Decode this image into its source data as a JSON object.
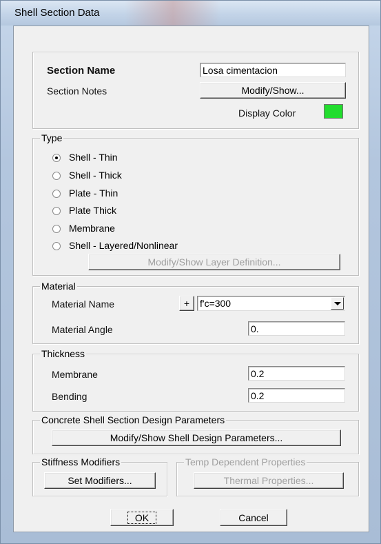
{
  "window": {
    "title": "Shell Section Data"
  },
  "colors": {
    "display_color": "#22dd2e"
  },
  "section": {
    "name_label": "Section Name",
    "name_value": "Losa cimentacion",
    "notes_label": "Section Notes",
    "notes_button": "Modify/Show...",
    "display_color_label": "Display Color"
  },
  "type": {
    "legend": "Type",
    "options": [
      {
        "label": "Shell - Thin",
        "checked": true
      },
      {
        "label": "Shell - Thick",
        "checked": false
      },
      {
        "label": "Plate - Thin",
        "checked": false
      },
      {
        "label": "Plate Thick",
        "checked": false
      },
      {
        "label": "Membrane",
        "checked": false
      },
      {
        "label": "Shell - Layered/Nonlinear",
        "checked": false
      }
    ],
    "layer_button": "Modify/Show Layer Definition..."
  },
  "material": {
    "legend": "Material",
    "name_label": "Material Name",
    "plus_button": "+",
    "name_value": "f'c=300",
    "angle_label": "Material Angle",
    "angle_value": "0."
  },
  "thickness": {
    "legend": "Thickness",
    "membrane_label": "Membrane",
    "membrane_value": "0.2",
    "bending_label": "Bending",
    "bending_value": "0.2"
  },
  "design": {
    "legend": "Concrete Shell Section Design Parameters",
    "button": "Modify/Show Shell Design Parameters..."
  },
  "stiffness": {
    "legend": "Stiffness Modifiers",
    "button": "Set Modifiers..."
  },
  "temp": {
    "legend": "Temp Dependent Properties",
    "button": "Thermal Properties..."
  },
  "footer": {
    "ok": "OK",
    "cancel": "Cancel"
  }
}
